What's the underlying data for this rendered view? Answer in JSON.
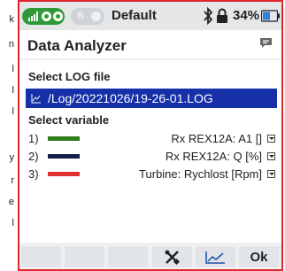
{
  "page_edge_text": [
    "k",
    "n",
    "l",
    "l",
    "l",
    "y",
    "r",
    "e",
    "l"
  ],
  "status_bar": {
    "b_label": "B",
    "profile": "Default",
    "battery_pct": "34%",
    "connection_color": "#2f9a35"
  },
  "header": {
    "title": "Data Analyzer",
    "icon": "message-icon"
  },
  "log": {
    "section_label": "Select LOG file",
    "value": "/Log/20221026/19-26-01.LOG",
    "icon": "chart-file-icon",
    "highlight_color": "#1530a8"
  },
  "variables": {
    "section_label": "Select variable",
    "items": [
      {
        "index": "1)",
        "label": "Rx REX12A: A1 []",
        "color": "#2e7d1f"
      },
      {
        "index": "2)",
        "label": "Rx REX12A: Q [%]",
        "color": "#13214a"
      },
      {
        "index": "3)",
        "label": "Turbine: Rychlost [Rpm]",
        "color": "#e03030"
      }
    ]
  },
  "bottom_bar": {
    "tools_icon": "tools-icon",
    "graph_icon": "graph-icon",
    "ok_label": "Ok"
  },
  "frame_color": "#e0262b"
}
